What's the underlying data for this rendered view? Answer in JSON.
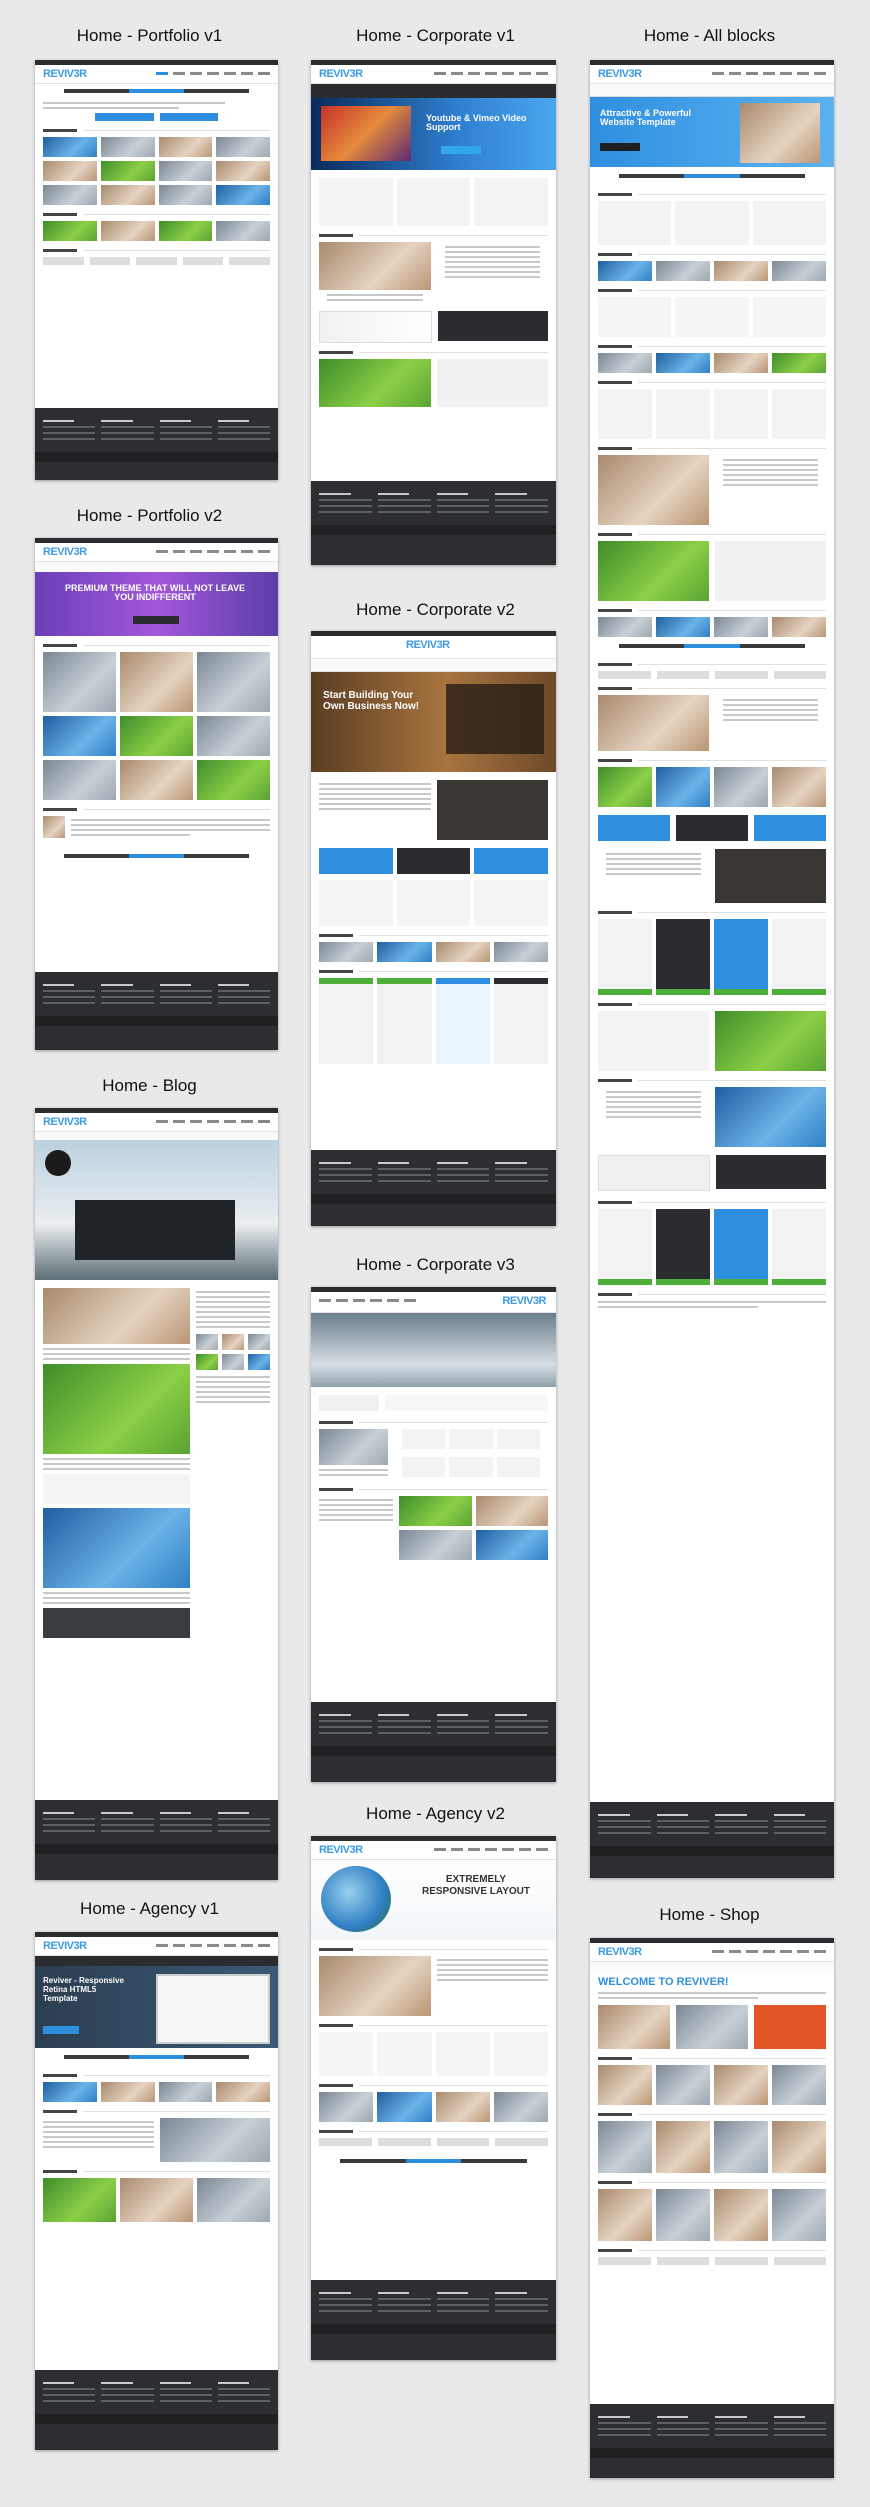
{
  "titles": {
    "portfolio_v1": "Home - Portfolio v1",
    "corporate_v1": "Home - Corporate v1",
    "all_blocks": "Home - All blocks",
    "portfolio_v2": "Home - Portfolio v2",
    "corporate_v2": "Home - Corporate v2",
    "blog": "Home - Blog",
    "corporate_v3": "Home - Corporate v3",
    "agency_v2": "Home - Agency v2",
    "agency_v1": "Home - Agency v1",
    "shop": "Home - Shop"
  },
  "brand": {
    "logo_main": "REVIV",
    "logo_accent": "3R"
  },
  "banners": {
    "corporate_v1": "Youtube & Vimeo Video Support",
    "all_blocks": "Attractive & Powerful Website Template",
    "portfolio_v2": "PREMIUM THEME THAT WILL NOT LEAVE YOU INDIFFERENT",
    "corporate_v2": "Start Building Your Own Business Now!",
    "agency_v2": "EXTREMELY RESPONSIVE LAYOUT",
    "agency_v1": "Reviver - Responsive Retina HTML5 Template",
    "shop": "WELCOME TO REVIVER!"
  }
}
